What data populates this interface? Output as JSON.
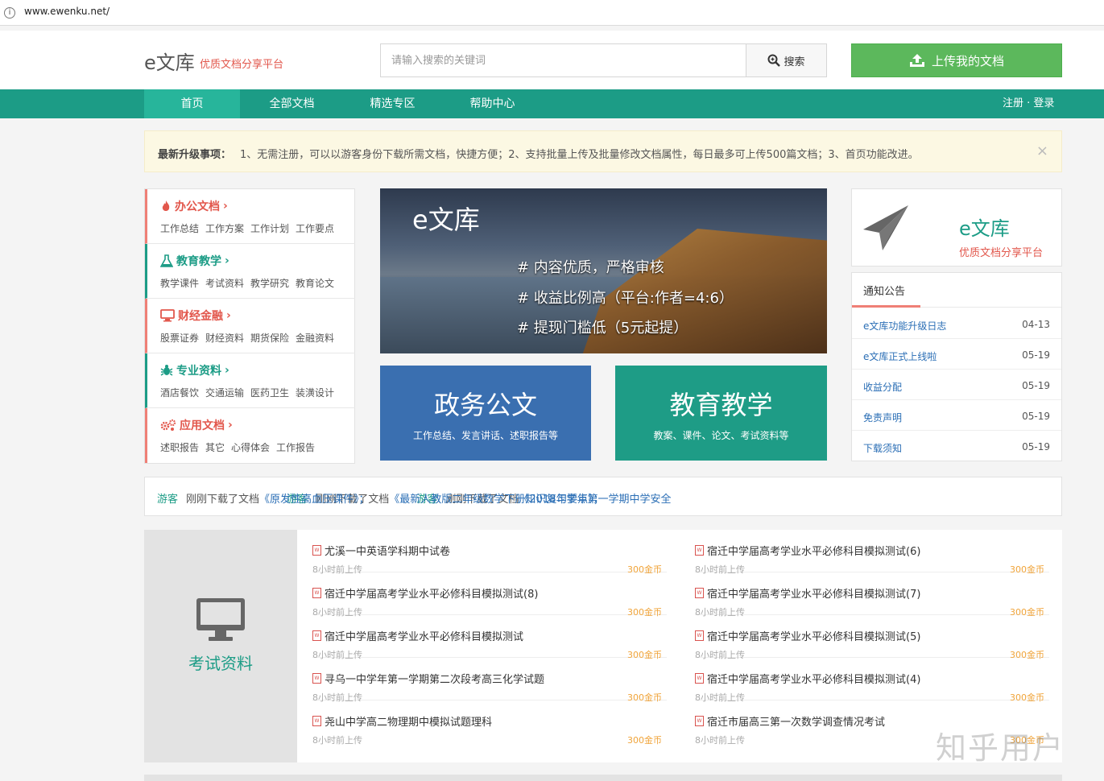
{
  "browser": {
    "url": "www.ewenku.net/"
  },
  "header": {
    "logo": "e文库",
    "slogan": "优质文档分享平台",
    "search_placeholder": "请输入搜索的关键词",
    "search_button": "搜索",
    "upload_button": "上传我的文档"
  },
  "nav": {
    "items": [
      "首页",
      "全部文档",
      "精选专区",
      "帮助中心"
    ],
    "active": "首页",
    "login": "注册 · 登录"
  },
  "notice": {
    "title": "最新升级事项：",
    "text": "1、无需注册，可以以游客身份下载所需文档，快捷方便；2、支持批量上传及批量修改文档属性，每日最多可上传500篇文档；3、首页功能改进。",
    "close": "×"
  },
  "categories": [
    {
      "title": "办公文档",
      "icon": "flame-icon",
      "color": "#e2574c",
      "subs": [
        "工作总结",
        "工作方案",
        "工作计划",
        "工作要点"
      ]
    },
    {
      "title": "教育教学",
      "icon": "flask-icon",
      "color": "#1c9c86",
      "subs": [
        "教学课件",
        "考试资料",
        "教学研究",
        "教育论文"
      ]
    },
    {
      "title": "财经金融",
      "icon": "monitor-icon",
      "color": "#e2574c",
      "subs": [
        "股票证券",
        "财经资料",
        "期货保险",
        "金融资料"
      ]
    },
    {
      "title": "专业资料",
      "icon": "bug-icon",
      "color": "#1c9c86",
      "subs": [
        "酒店餐饮",
        "交通运输",
        "医药卫生",
        "装潢设计"
      ]
    },
    {
      "title": "应用文档",
      "icon": "gears-icon",
      "color": "#e2574c",
      "subs": [
        "述职报告",
        "其它",
        "心得体会",
        "工作报告"
      ]
    }
  ],
  "banner": {
    "title": "e文库",
    "lines": [
      "# 内容优质，严格审核",
      "# 收益比例高（平台:作者=4:6）",
      "# 提现门槛低（5元起提）"
    ]
  },
  "tiles": [
    {
      "title": "政务公文",
      "sub": "工作总结、发言讲话、述职报告等",
      "color": "#3a6fb0"
    },
    {
      "title": "教育教学",
      "sub": "教案、课件、论文、考试资料等",
      "color": "#1e9c86"
    }
  ],
  "brand": {
    "name": "e文库",
    "sub": "优质文档分享平台"
  },
  "announcements": {
    "tab": "通知公告",
    "items": [
      {
        "title": "e文库功能升级日志",
        "date": "04-13"
      },
      {
        "title": "e文库正式上线啦",
        "date": "05-19"
      },
      {
        "title": "收益分配",
        "date": "05-19"
      },
      {
        "title": "免责声明",
        "date": "05-19"
      },
      {
        "title": "下载须知",
        "date": "05-19"
      }
    ]
  },
  "ticker": [
    {
      "user": "游客",
      "action": "刚刚下载了文档",
      "doc": "《原发性高血压课件》；"
    },
    {
      "user": "游客",
      "action": "刚刚下载了文档",
      "doc": "《最新人教版二年级数学下册知识复习要点》；"
    },
    {
      "user": "游客",
      "action": "刚刚下载了文档",
      "doc": "《2018年学年第一学期中学安全"
    }
  ],
  "section": {
    "label": "考试资料",
    "docs_left": [
      {
        "title": "尤溪一中英语学科期中试卷",
        "time": "8小时前上传",
        "price": "300金币"
      },
      {
        "title": "宿迁中学届高考学业水平必修科目模拟测试(8)",
        "time": "8小时前上传",
        "price": "300金币"
      },
      {
        "title": "宿迁中学届高考学业水平必修科目模拟测试",
        "time": "8小时前上传",
        "price": "300金币"
      },
      {
        "title": "寻乌一中学年第一学期第二次段考高三化学试题",
        "time": "8小时前上传",
        "price": "300金币"
      },
      {
        "title": "尧山中学高二物理期中模拟试题理科",
        "time": "8小时前上传",
        "price": "300金币"
      }
    ],
    "docs_right": [
      {
        "title": "宿迁中学届高考学业水平必修科目模拟测试(6)",
        "time": "8小时前上传",
        "price": "300金币"
      },
      {
        "title": "宿迁中学届高考学业水平必修科目模拟测试(7)",
        "time": "8小时前上传",
        "price": "300金币"
      },
      {
        "title": "宿迁中学届高考学业水平必修科目模拟测试(5)",
        "time": "8小时前上传",
        "price": "300金币"
      },
      {
        "title": "宿迁中学届高考学业水平必修科目模拟测试(4)",
        "time": "8小时前上传",
        "price": "300金币"
      },
      {
        "title": "宿迁市届高三第一次数学调查情况考试",
        "time": "8小时前上传",
        "price": "300金币"
      }
    ]
  },
  "watermark": "知乎用户",
  "colors": {
    "primary": "#1c9c86",
    "accent_red": "#e2574c",
    "upload_green": "#5cb85c",
    "price_orange": "#f0a43a"
  }
}
